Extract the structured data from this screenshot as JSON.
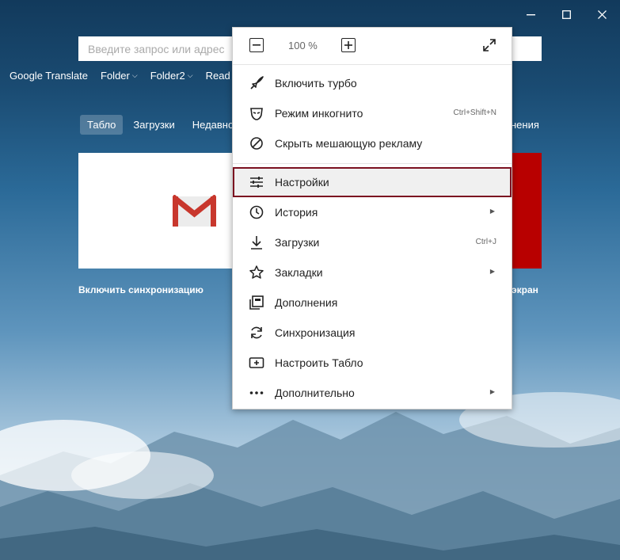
{
  "window": {
    "menu_icon": "hamburger-menu-icon",
    "minimize_icon": "minimize-icon",
    "maximize_icon": "maximize-icon",
    "close_icon": "close-icon"
  },
  "search": {
    "placeholder": "Введите запрос или адрес"
  },
  "bookmarks": [
    {
      "label": "Google Translate"
    },
    {
      "label": "Folder"
    },
    {
      "label": "Folder2"
    },
    {
      "label": "Read"
    }
  ],
  "tabs": [
    {
      "label": "Табло"
    },
    {
      "label": "Загрузки"
    },
    {
      "label": "Недавно"
    }
  ],
  "tab_right_fragment": "нения",
  "tiles": {
    "sync_link": "Включить синхронизацию",
    "screen_link": "экран"
  },
  "menu": {
    "zoom": {
      "value": "100 %",
      "minus_icon": "zoom-out-icon",
      "plus_icon": "zoom-in-icon",
      "fullscreen_icon": "fullscreen-icon"
    },
    "items": [
      {
        "label": "Включить турбо",
        "icon": "rocket-icon"
      },
      {
        "label": "Режим инкогнито",
        "icon": "incognito-mask-icon",
        "shortcut": "Ctrl+Shift+N"
      },
      {
        "label": "Скрыть мешающую рекламу",
        "icon": "block-icon"
      },
      {
        "label": "Настройки",
        "icon": "settings-sliders-icon",
        "highlighted": true
      },
      {
        "label": "История",
        "icon": "clock-icon",
        "submenu": true
      },
      {
        "label": "Загрузки",
        "icon": "download-icon",
        "shortcut": "Ctrl+J"
      },
      {
        "label": "Закладки",
        "icon": "star-icon",
        "submenu": true
      },
      {
        "label": "Дополнения",
        "icon": "extensions-icon"
      },
      {
        "label": "Синхронизация",
        "icon": "sync-icon"
      },
      {
        "label": "Настроить Табло",
        "icon": "add-tile-icon"
      },
      {
        "label": "Дополнительно",
        "icon": "more-dots-icon",
        "submenu": true
      }
    ]
  },
  "colors": {
    "highlight_border": "#7b1020",
    "red_tile": "#b80000"
  }
}
